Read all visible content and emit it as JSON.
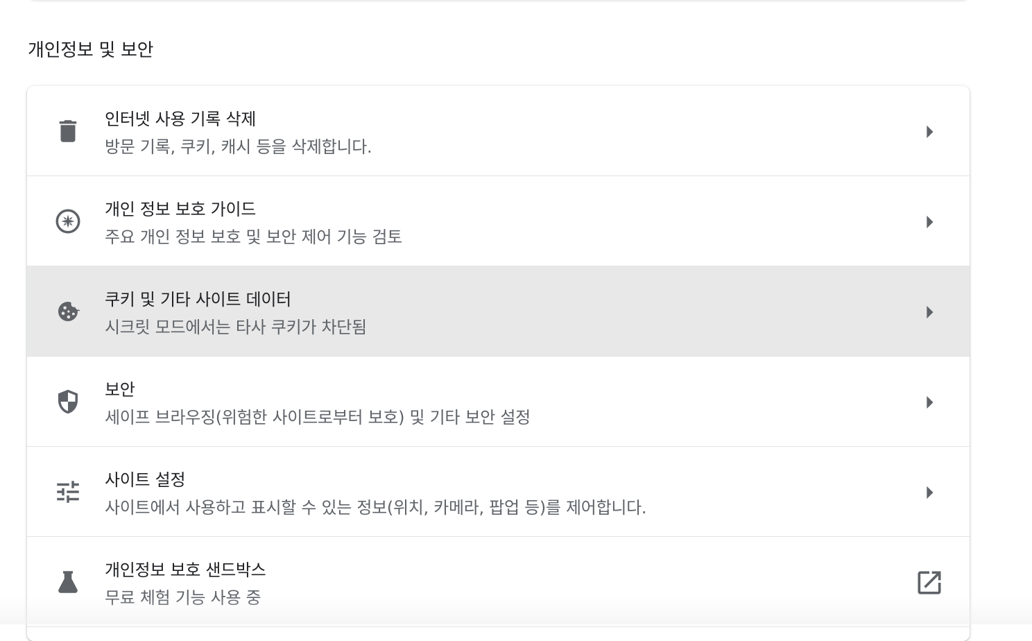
{
  "section": {
    "title": "개인정보 및 보안"
  },
  "items": [
    {
      "label": "인터넷 사용 기록 삭제",
      "sublabel": "방문 기록, 쿠키, 캐시 등을 삭제합니다.",
      "icon": "trash-icon",
      "trailing_icon": "arrow-right-icon"
    },
    {
      "label": "개인 정보 보호 가이드",
      "sublabel": "주요 개인 정보 보호 및 보안 제어 기능 검토",
      "icon": "compass-icon",
      "trailing_icon": "arrow-right-icon"
    },
    {
      "label": "쿠키 및 기타 사이트 데이터",
      "sublabel": "시크릿 모드에서는 타사 쿠키가 차단됨",
      "icon": "cookie-icon",
      "trailing_icon": "arrow-right-icon"
    },
    {
      "label": "보안",
      "sublabel": "세이프 브라우징(위험한 사이트로부터 보호) 및 기타 보안 설정",
      "icon": "shield-icon",
      "trailing_icon": "arrow-right-icon"
    },
    {
      "label": "사이트 설정",
      "sublabel": "사이트에서 사용하고 표시할 수 있는 정보(위치, 카메라, 팝업 등)를 제어합니다.",
      "icon": "tune-icon",
      "trailing_icon": "arrow-right-icon"
    },
    {
      "label": "개인정보 보호 샌드박스",
      "sublabel": "무료 체험 기능 사용 중",
      "icon": "flask-icon",
      "trailing_icon": "open-in-new-icon"
    }
  ],
  "colors": {
    "icon": "#5f6368",
    "text_primary": "#202124",
    "text_secondary": "#5f6368",
    "hover_row": "#e8e8e8"
  }
}
